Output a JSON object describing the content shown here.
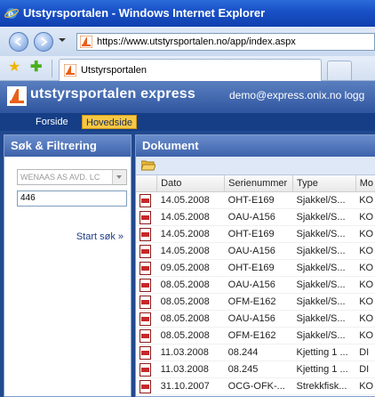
{
  "window": {
    "title": "Utstyrsportalen - Windows Internet Explorer"
  },
  "browser": {
    "url": "https://www.utstyrsportalen.no/app/index.aspx",
    "tab_label": "Utstyrsportalen"
  },
  "app": {
    "name": "utstyrsportalen express",
    "user": "demo@express.onix.no logg",
    "nav": {
      "forside": "Forside",
      "hovedside": "Hovedside"
    }
  },
  "search": {
    "title": "Søk & Filtrering",
    "select_value": "WENAAS AS AVD. LC",
    "text_value": "446",
    "start_link": "Start søk »"
  },
  "documents": {
    "title": "Dokument",
    "columns": [
      "Dato",
      "Serienummer",
      "Type",
      "Mo"
    ],
    "rows": [
      [
        "14.05.2008",
        "OHT-E169",
        "Sjakkel/S...",
        "KO"
      ],
      [
        "14.05.2008",
        "OAU-A156",
        "Sjakkel/S...",
        "KO"
      ],
      [
        "14.05.2008",
        "OHT-E169",
        "Sjakkel/S...",
        "KO"
      ],
      [
        "14.05.2008",
        "OAU-A156",
        "Sjakkel/S...",
        "KO"
      ],
      [
        "09.05.2008",
        "OHT-E169",
        "Sjakkel/S...",
        "KO"
      ],
      [
        "08.05.2008",
        "OAU-A156",
        "Sjakkel/S...",
        "KO"
      ],
      [
        "08.05.2008",
        "OFM-E162",
        "Sjakkel/S...",
        "KO"
      ],
      [
        "08.05.2008",
        "OAU-A156",
        "Sjakkel/S...",
        "KO"
      ],
      [
        "08.05.2008",
        "OFM-E162",
        "Sjakkel/S...",
        "KO"
      ],
      [
        "11.03.2008",
        "08.244",
        "Kjetting 1 ...",
        "DI"
      ],
      [
        "11.03.2008",
        "08.245",
        "Kjetting 1 ...",
        "DI"
      ],
      [
        "31.10.2007",
        "OCG-OFK-...",
        "Strekkfisk...",
        "KO"
      ]
    ]
  }
}
